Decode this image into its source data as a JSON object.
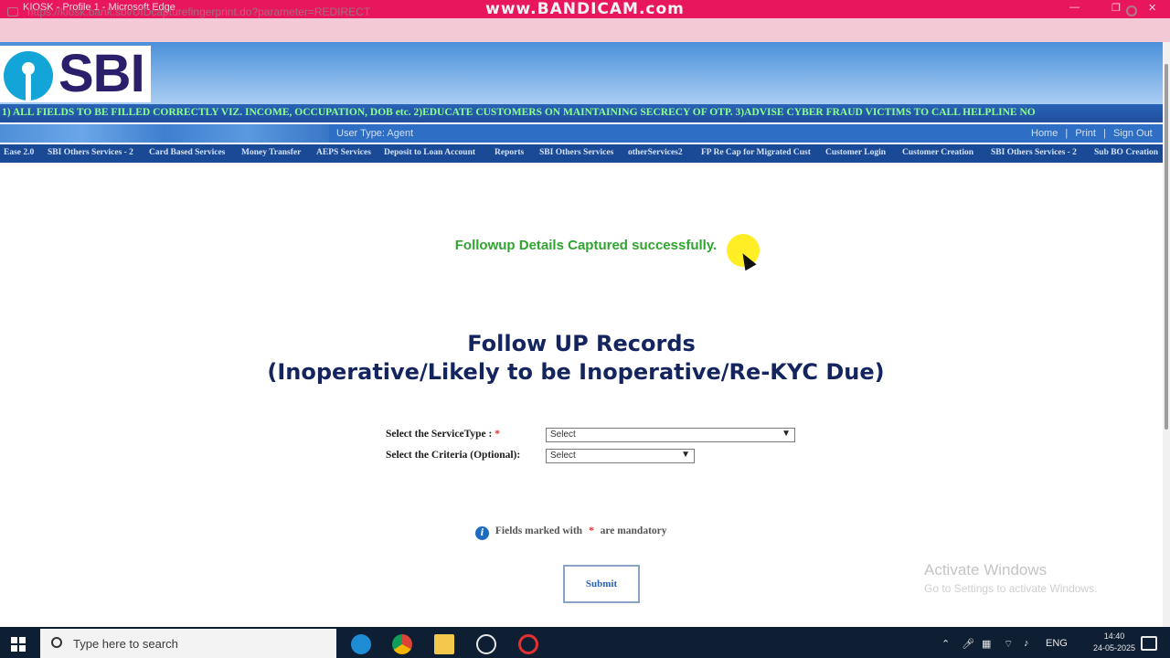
{
  "window": {
    "title": "KIOSK - Profile 1 - Microsoft Edge",
    "watermark": "www.BANDICAM.com",
    "controls": [
      "—",
      "❐",
      "✕"
    ]
  },
  "browser": {
    "url": "https://kiosk.bank.sbi/UIDcapturefingerprint.do?parameter=REDIRECT"
  },
  "header": {
    "logo_text": "SBI",
    "ticker": "1) ALL FIELDS TO BE FILLED CORRECTLY VIZ. INCOME, OCCUPATION, DOB etc. 2)EDUCATE CUSTOMERS ON MAINTAINING SECRECY OF OTP. 3)ADVISE CYBER FRAUD VICTIMS TO CALL HELPLINE NO",
    "user_type": "User Type: Agent",
    "links": {
      "home": "Home",
      "sep1": "|",
      "print": "Print",
      "sep2": "|",
      "sign_out": "Sign Out"
    }
  },
  "menu": {
    "items": [
      "Ease 2.0",
      "SBI Others Services - 2",
      "Card Based Services",
      "Money Transfer",
      "AEPS Services",
      "Deposit to Loan Account",
      "Reports",
      "SBI Others Services",
      "otherServices2",
      "FP Re Cap for Migrated Cust",
      "Customer Login",
      "Customer Creation",
      "SBI Others Services - 2",
      "Sub BO Creation"
    ]
  },
  "main": {
    "success_message": "Followup Details Captured successfully.",
    "title_line1": "Follow UP Records",
    "title_line2": "(Inoperative/Likely to be Inoperative/Re-KYC Due)",
    "service_type_label": "Select the ServiceType :",
    "required_mark": "*",
    "service_type_value": "Select",
    "criteria_label": "Select the Criteria (Optional):",
    "criteria_value": "Select",
    "mandatory_note_prefix": "Fields marked with",
    "mandatory_note_suffix": "are mandatory",
    "submit_label": "Submit"
  },
  "watermark_windows": {
    "line1": "Activate Windows",
    "line2": "Go to Settings to activate Windows."
  },
  "taskbar": {
    "search_placeholder": "Type here to search",
    "tray_lang": "ENG",
    "time": "14:40",
    "date": "24-05-2025"
  },
  "colors": {
    "success_green": "#2fa52f",
    "heading_navy": "#14245e",
    "sbi_blue": "#14a5d8",
    "sbi_purple": "#2a1f6b",
    "menu_blue": "#1a4a96"
  }
}
